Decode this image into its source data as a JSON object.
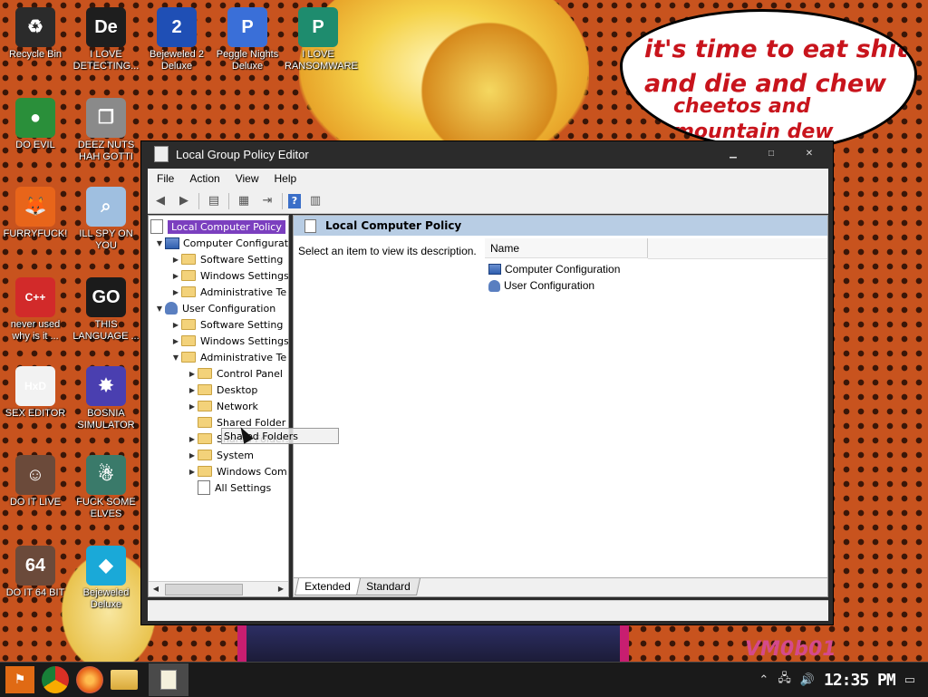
{
  "wallpaper": {
    "speech_lines": [
      "it's time to eat shit",
      "and die and chew",
      "cheetos and",
      "mountain dew"
    ],
    "watermark": "VM0b01"
  },
  "desktop_icons": [
    {
      "label": "Recycle Bin",
      "icon": "recycle-bin-icon",
      "color": "#2b2b2b",
      "glyph": "♻"
    },
    {
      "label": "I LOVE DETECTING...",
      "icon": "de-app-icon",
      "color": "#1e1e1e",
      "glyph": "De"
    },
    {
      "label": "Bejeweled 2 Deluxe",
      "icon": "bejeweled2-icon",
      "color": "#1f4fb5",
      "glyph": "2"
    },
    {
      "label": "Peggle Nights Deluxe",
      "icon": "peggle-icon",
      "color": "#3a6fd8",
      "glyph": "P"
    },
    {
      "label": "I LOVE RANSOMWARE",
      "icon": "publisher-icon",
      "color": "#1e8c6e",
      "glyph": "P"
    },
    {
      "label": "DO EVIL",
      "icon": "chrome-icon",
      "color": "#2a8f3a",
      "glyph": "●"
    },
    {
      "label": "DEEZ NUTS HAH GOTTI",
      "icon": "copy-windows-icon",
      "color": "#8a8a8a",
      "glyph": "❐"
    },
    {
      "label": "FURRYFUCK!",
      "icon": "firefox-icon",
      "color": "#e8651a",
      "glyph": "🦊"
    },
    {
      "label": "ILL SPY ON YOU",
      "icon": "spy-icon",
      "color": "#9fbfe0",
      "glyph": "⌕"
    },
    {
      "label": "never used why is it ...",
      "icon": "devcpp-icon",
      "color": "#d22a2a",
      "glyph": "C++"
    },
    {
      "label": "THIS LANGUAGE ...",
      "icon": "goland-icon",
      "color": "#1b1b1b",
      "glyph": "GO"
    },
    {
      "label": "SEX EDITOR",
      "icon": "hxd-icon",
      "color": "#f2f2f2",
      "glyph": "HxD"
    },
    {
      "label": "BOSNIA SIMULATOR",
      "icon": "mine-icon",
      "color": "#4a3fb0",
      "glyph": "✸"
    },
    {
      "label": "DO IT LIVE",
      "icon": "portrait-icon",
      "color": "#6b4a3a",
      "glyph": "☺"
    },
    {
      "label": "FUCK SOME ELVES",
      "icon": "santa-icon",
      "color": "#3a7a6a",
      "glyph": "☃"
    },
    {
      "label": "DO IT 64 BIT",
      "icon": "portrait64-icon",
      "color": "#6b4a3a",
      "glyph": "64"
    },
    {
      "label": "Bejeweled Deluxe",
      "icon": "bejeweled-icon",
      "color": "#1aa9d8",
      "glyph": "◆"
    }
  ],
  "window": {
    "title": "Local Group Policy Editor",
    "controls": [
      "minimize",
      "maximize",
      "close"
    ],
    "menu": [
      "File",
      "Action",
      "View",
      "Help"
    ],
    "tree": [
      {
        "label": "Local Computer Policy",
        "icon": "policy",
        "selected": true
      },
      {
        "label": "Computer Configurati",
        "icon": "pc",
        "twisty": "▼"
      },
      {
        "label": "Software Setting",
        "icon": "folder",
        "twisty": "▶"
      },
      {
        "label": "Windows Settings",
        "icon": "folder",
        "twisty": "▶"
      },
      {
        "label": "Administrative Te",
        "icon": "folder",
        "twisty": "▶"
      },
      {
        "label": "User Configuration",
        "icon": "user",
        "twisty": "▼"
      },
      {
        "label": "Software Setting",
        "icon": "folder",
        "twisty": "▶"
      },
      {
        "label": "Windows Settings",
        "icon": "folder",
        "twisty": "▶"
      },
      {
        "label": "Administrative Te",
        "icon": "folder",
        "twisty": "▼"
      },
      {
        "label": "Control Panel",
        "icon": "folder",
        "twisty": "▶"
      },
      {
        "label": "Desktop",
        "icon": "folder",
        "twisty": "▶"
      },
      {
        "label": "Network",
        "icon": "folder",
        "twisty": "▶"
      },
      {
        "label": "Shared Folder",
        "icon": "folder",
        "twisty": ""
      },
      {
        "label": "Shared Folders",
        "icon": "folder",
        "twisty": "▶"
      },
      {
        "label": "System",
        "icon": "folder",
        "twisty": "▶"
      },
      {
        "label": "Windows Com",
        "icon": "folder",
        "twisty": "▶"
      },
      {
        "label": "All Settings",
        "icon": "policy",
        "twisty": ""
      }
    ],
    "drag_ghost": "Shared Folders",
    "right_pane": {
      "header": "Local Computer Policy",
      "description": "Select an item to view its description.",
      "column_name": "Name",
      "items": [
        {
          "label": "Computer Configuration",
          "icon": "pc"
        },
        {
          "label": "User Configuration",
          "icon": "user"
        }
      ],
      "tabs": [
        {
          "label": "Extended",
          "active": true
        },
        {
          "label": "Standard",
          "active": false
        }
      ]
    }
  },
  "taskbar": {
    "clock": "12:35 PM",
    "apps": [
      "start-button",
      "chrome",
      "firefox",
      "explorer",
      "group-policy-editor"
    ]
  }
}
